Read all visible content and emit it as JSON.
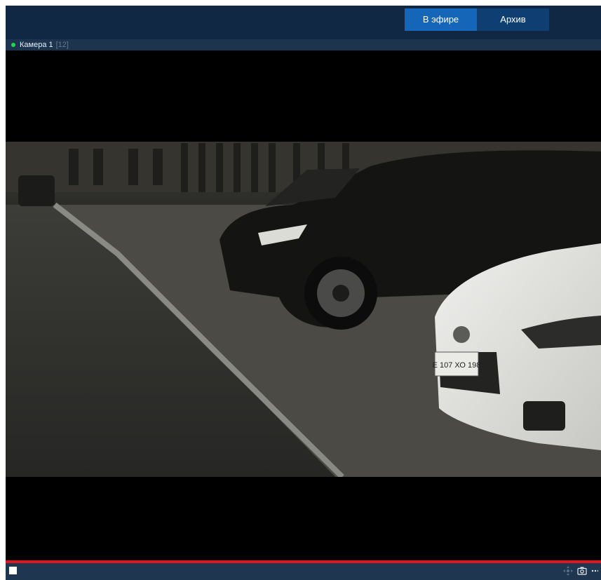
{
  "header": {
    "tabs": [
      {
        "label": "В эфире",
        "active": true
      },
      {
        "label": "Архив",
        "active": false
      }
    ]
  },
  "camera": {
    "name": "Камера 1",
    "number": "[12]",
    "status_color": "#1fd84a"
  },
  "video": {
    "plate_text": "Е 107 ХО 198"
  },
  "toolbar": {
    "icons": [
      "ptz-icon",
      "camera-icon",
      "more-icon"
    ]
  },
  "colors": {
    "header_bg": "#102844",
    "active_tab": "#1565b8",
    "recording_line": "#e5131d"
  }
}
